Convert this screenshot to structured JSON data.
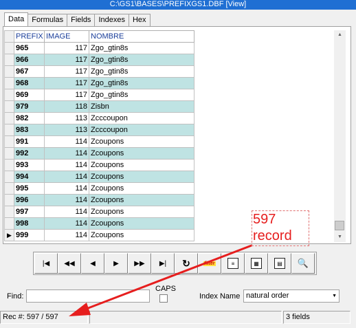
{
  "window": {
    "title": "C:\\GS1\\BASES\\PREFIXGS1.DBF [View]"
  },
  "tabs": [
    {
      "label": "Data",
      "active": true
    },
    {
      "label": "Formulas"
    },
    {
      "label": "Fields"
    },
    {
      "label": "Indexes"
    },
    {
      "label": "Hex"
    }
  ],
  "grid": {
    "columns": [
      "PREFIX",
      "IMAGE",
      "NOMBRE"
    ],
    "rows": [
      {
        "prefix": "965",
        "image": "117",
        "nombre": "Zgo_gtin8s"
      },
      {
        "prefix": "966",
        "image": "117",
        "nombre": "Zgo_gtin8s"
      },
      {
        "prefix": "967",
        "image": "117",
        "nombre": "Zgo_gtin8s"
      },
      {
        "prefix": "968",
        "image": "117",
        "nombre": "Zgo_gtin8s"
      },
      {
        "prefix": "969",
        "image": "117",
        "nombre": "Zgo_gtin8s"
      },
      {
        "prefix": "979",
        "image": "118",
        "nombre": "Zisbn"
      },
      {
        "prefix": "982",
        "image": "113",
        "nombre": "Zcccoupon"
      },
      {
        "prefix": "983",
        "image": "113",
        "nombre": "Zcccoupon"
      },
      {
        "prefix": "991",
        "image": "114",
        "nombre": "Zcoupons"
      },
      {
        "prefix": "992",
        "image": "114",
        "nombre": "Zcoupons"
      },
      {
        "prefix": "993",
        "image": "114",
        "nombre": "Zcoupons"
      },
      {
        "prefix": "994",
        "image": "114",
        "nombre": "Zcoupons"
      },
      {
        "prefix": "995",
        "image": "114",
        "nombre": "Zcoupons"
      },
      {
        "prefix": "996",
        "image": "114",
        "nombre": "Zcoupons"
      },
      {
        "prefix": "997",
        "image": "114",
        "nombre": "Zcoupons"
      },
      {
        "prefix": "998",
        "image": "114",
        "nombre": "Zcoupons"
      },
      {
        "prefix": "999",
        "image": "114",
        "nombre": "Zcoupons",
        "current": true
      }
    ]
  },
  "nav": {
    "first": "first-record-icon",
    "prev_page": "prev-page-icon",
    "prev": "prev-record-icon",
    "next": "next-record-icon",
    "next_page": "next-page-icon",
    "last": "last-record-icon",
    "refresh": "refresh-icon",
    "filter_label": "filter"
  },
  "find": {
    "label": "Find:",
    "value": ""
  },
  "caps": {
    "label": "CAPS"
  },
  "index": {
    "label": "Index Name",
    "value": "natural order"
  },
  "status": {
    "record": "Rec #: 597 / 597",
    "fields": "3 fields"
  },
  "annotation": {
    "line1": "597",
    "line2": "record",
    "color": "#e61e1e"
  },
  "colors": {
    "title_bar": "#1f6fd3",
    "row_alt": "#bfe3e3",
    "header_text": "#1a3e9a"
  }
}
